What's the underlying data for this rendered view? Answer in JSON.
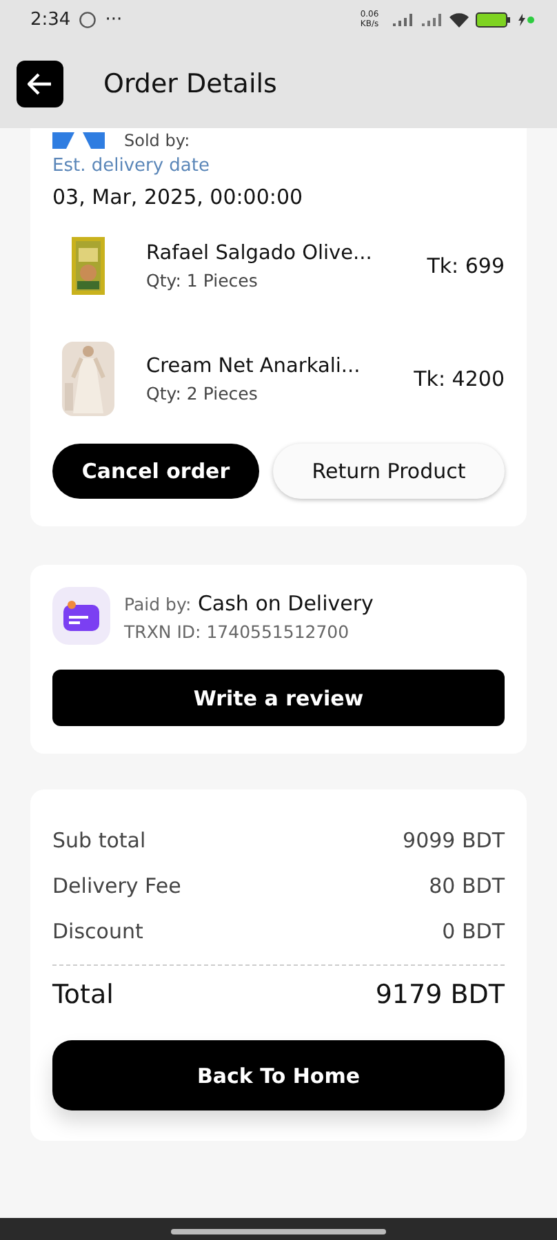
{
  "status_bar": {
    "time": "2:34",
    "more": "···",
    "net_speed": "0.06 KB/s"
  },
  "header": {
    "title": "Order Details"
  },
  "order": {
    "sold_by_label": "Sold by:",
    "delivery_label": "Est. delivery date",
    "delivery_date": "03, Mar, 2025, 00:00:00",
    "items": [
      {
        "name": "Rafael Salgado Olive...",
        "qty": "Qty: 1 Pieces",
        "price": "Tk: 699"
      },
      {
        "name": "Cream Net Anarkali...",
        "qty": "Qty: 2 Pieces",
        "price": "Tk: 4200"
      }
    ],
    "buttons": [
      {
        "label": "Cancel order",
        "kind": "primary"
      },
      {
        "label": "Return Product",
        "kind": "secondary"
      }
    ]
  },
  "payment": {
    "paid_by_label": "Paid by:",
    "method": "Cash on Delivery",
    "trxn": "TRXN ID: 1740551512700",
    "button": "Write a review"
  },
  "summary": {
    "rows": [
      {
        "label": "Sub total",
        "value": "9099 BDT"
      },
      {
        "label": "Delivery Fee",
        "value": "80 BDT"
      },
      {
        "label": "Discount",
        "value": "0 BDT"
      }
    ],
    "total_label": "Total",
    "total_value": "9179 BDT",
    "button": "Back To Home"
  }
}
